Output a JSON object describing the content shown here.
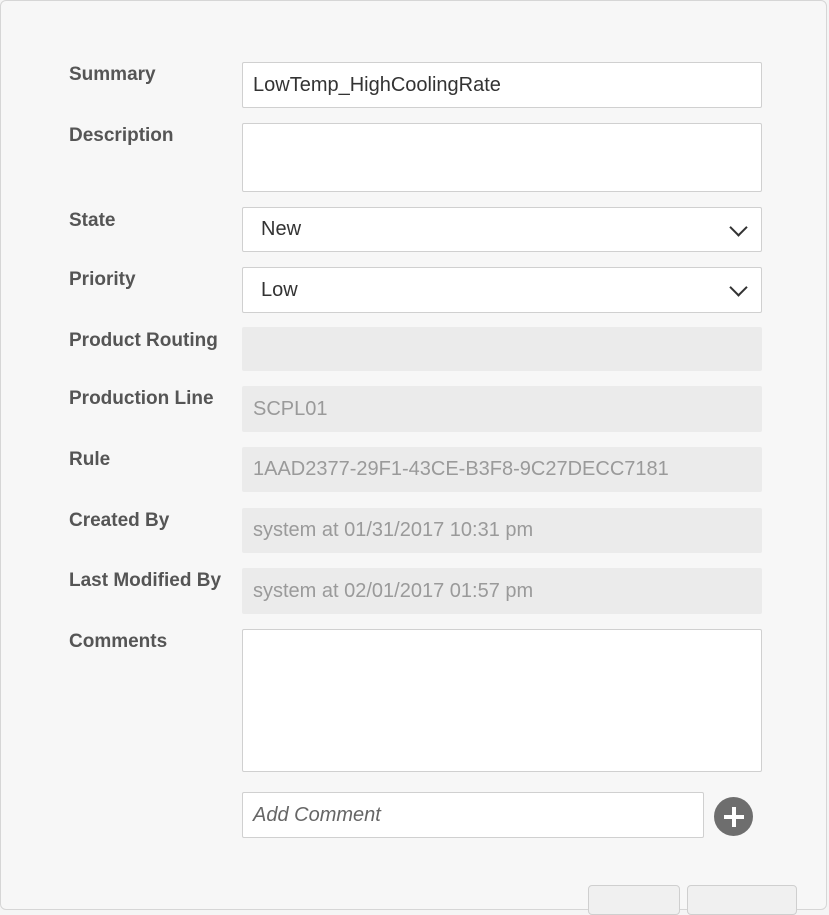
{
  "form": {
    "summary": {
      "label": "Summary",
      "value": "LowTemp_HighCoolingRate"
    },
    "description": {
      "label": "Description",
      "value": ""
    },
    "state": {
      "label": "State",
      "value": "New"
    },
    "priority": {
      "label": "Priority",
      "value": "Low"
    },
    "product_routing": {
      "label": "Product Routing",
      "value": ""
    },
    "production_line": {
      "label": "Production Line",
      "value": "SCPL01"
    },
    "rule": {
      "label": "Rule",
      "value": "1AAD2377-29F1-43CE-B3F8-9C27DECC7181"
    },
    "created_by": {
      "label": "Created By",
      "value": "system at 01/31/2017 10:31 pm"
    },
    "last_modified_by": {
      "label": "Last Modified By",
      "value": "system at 02/01/2017 01:57 pm"
    },
    "comments": {
      "label": "Comments",
      "value": ""
    },
    "add_comment": {
      "placeholder": "Add Comment"
    }
  },
  "icons": {
    "add_comment": "plus-circle-icon",
    "dropdown": "chevron-down-icon"
  },
  "colors": {
    "label": "#555555",
    "readonly_bg": "#ebebeb",
    "readonly_text": "#9a9a9a"
  }
}
